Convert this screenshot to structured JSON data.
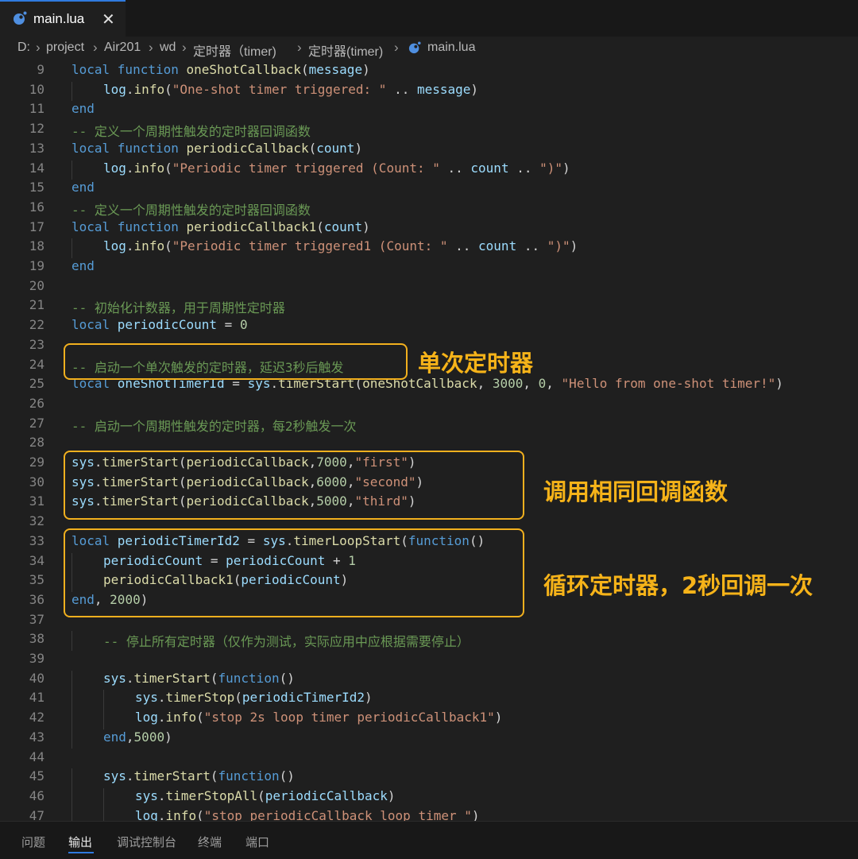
{
  "tab": {
    "title": "main.lua",
    "close": "✕"
  },
  "breadcrumb": [
    "D:",
    "project",
    "Air201",
    "wd",
    "定时器（timer)",
    "定时器(timer)",
    "main.lua"
  ],
  "code": [
    {
      "n": "9",
      "indent": 0,
      "tokens": [
        [
          "kw",
          "local "
        ],
        [
          "kw",
          "function "
        ],
        [
          "fn",
          "oneShotCallback"
        ],
        [
          "op",
          "("
        ],
        [
          "vr",
          "message"
        ],
        [
          "op",
          ")"
        ]
      ]
    },
    {
      "n": "10",
      "indent": 1,
      "tokens": [
        [
          "vr",
          "log"
        ],
        [
          "op",
          "."
        ],
        [
          "fn",
          "info"
        ],
        [
          "op",
          "("
        ],
        [
          "st",
          "\"One-shot timer triggered: \""
        ],
        [
          "op",
          " .. "
        ],
        [
          "vr",
          "message"
        ],
        [
          "op",
          ")"
        ]
      ]
    },
    {
      "n": "11",
      "indent": 0,
      "tokens": [
        [
          "kw",
          "end"
        ]
      ]
    },
    {
      "n": "12",
      "indent": 0,
      "tokens": [
        [
          "cm",
          "-- 定义一个周期性触发的定时器回调函数"
        ]
      ]
    },
    {
      "n": "13",
      "indent": 0,
      "tokens": [
        [
          "kw",
          "local "
        ],
        [
          "kw",
          "function "
        ],
        [
          "fn",
          "periodicCallback"
        ],
        [
          "op",
          "("
        ],
        [
          "vr",
          "count"
        ],
        [
          "op",
          ")"
        ]
      ]
    },
    {
      "n": "14",
      "indent": 1,
      "tokens": [
        [
          "vr",
          "log"
        ],
        [
          "op",
          "."
        ],
        [
          "fn",
          "info"
        ],
        [
          "op",
          "("
        ],
        [
          "st",
          "\"Periodic timer triggered (Count: \""
        ],
        [
          "op",
          " .. "
        ],
        [
          "vr",
          "count"
        ],
        [
          "op",
          " .. "
        ],
        [
          "st",
          "\")\""
        ],
        [
          "op",
          ")"
        ]
      ]
    },
    {
      "n": "15",
      "indent": 0,
      "tokens": [
        [
          "kw",
          "end"
        ]
      ]
    },
    {
      "n": "16",
      "indent": 0,
      "tokens": [
        [
          "cm",
          "-- 定义一个周期性触发的定时器回调函数"
        ]
      ]
    },
    {
      "n": "17",
      "indent": 0,
      "tokens": [
        [
          "kw",
          "local "
        ],
        [
          "kw",
          "function "
        ],
        [
          "fn",
          "periodicCallback1"
        ],
        [
          "op",
          "("
        ],
        [
          "vr",
          "count"
        ],
        [
          "op",
          ")"
        ]
      ]
    },
    {
      "n": "18",
      "indent": 1,
      "tokens": [
        [
          "vr",
          "log"
        ],
        [
          "op",
          "."
        ],
        [
          "fn",
          "info"
        ],
        [
          "op",
          "("
        ],
        [
          "st",
          "\"Periodic timer triggered1 (Count: \""
        ],
        [
          "op",
          " .. "
        ],
        [
          "vr",
          "count"
        ],
        [
          "op",
          " .. "
        ],
        [
          "st",
          "\")\""
        ],
        [
          "op",
          ")"
        ]
      ]
    },
    {
      "n": "19",
      "indent": 0,
      "tokens": [
        [
          "kw",
          "end"
        ]
      ]
    },
    {
      "n": "20",
      "indent": 0,
      "tokens": []
    },
    {
      "n": "21",
      "indent": 0,
      "tokens": [
        [
          "cm",
          "-- 初始化计数器，用于周期性定时器"
        ]
      ]
    },
    {
      "n": "22",
      "indent": 0,
      "tokens": [
        [
          "kw",
          "local "
        ],
        [
          "vr",
          "periodicCount"
        ],
        [
          "op",
          " = "
        ],
        [
          "nm",
          "0"
        ]
      ]
    },
    {
      "n": "23",
      "indent": 0,
      "tokens": []
    },
    {
      "n": "24",
      "indent": 0,
      "tokens": [
        [
          "cm",
          "-- 启动一个单次触发的定时器，延迟3秒后触发"
        ]
      ]
    },
    {
      "n": "25",
      "indent": 0,
      "tokens": [
        [
          "kw",
          "local "
        ],
        [
          "vr",
          "oneShotTimerId"
        ],
        [
          "op",
          " = "
        ],
        [
          "vr",
          "sys"
        ],
        [
          "op",
          "."
        ],
        [
          "fn",
          "timerStart"
        ],
        [
          "op",
          "("
        ],
        [
          "fn",
          "oneShotCallback"
        ],
        [
          "op",
          ", "
        ],
        [
          "nm",
          "3000"
        ],
        [
          "op",
          ", "
        ],
        [
          "nm",
          "0"
        ],
        [
          "op",
          ", "
        ],
        [
          "st",
          "\"Hello from one-shot timer!\""
        ],
        [
          "op",
          ")"
        ]
      ]
    },
    {
      "n": "26",
      "indent": 0,
      "tokens": []
    },
    {
      "n": "27",
      "indent": 0,
      "tokens": [
        [
          "cm",
          "-- 启动一个周期性触发的定时器，每2秒触发一次"
        ]
      ]
    },
    {
      "n": "28",
      "indent": 0,
      "tokens": []
    },
    {
      "n": "29",
      "indent": 0,
      "tokens": [
        [
          "vr",
          "sys"
        ],
        [
          "op",
          "."
        ],
        [
          "fn",
          "timerStart"
        ],
        [
          "op",
          "("
        ],
        [
          "fn",
          "periodicCallback"
        ],
        [
          "op",
          ","
        ],
        [
          "nm",
          "7000"
        ],
        [
          "op",
          ","
        ],
        [
          "st",
          "\"first\""
        ],
        [
          "op",
          ")"
        ]
      ]
    },
    {
      "n": "30",
      "indent": 0,
      "tokens": [
        [
          "vr",
          "sys"
        ],
        [
          "op",
          "."
        ],
        [
          "fn",
          "timerStart"
        ],
        [
          "op",
          "("
        ],
        [
          "fn",
          "periodicCallback"
        ],
        [
          "op",
          ","
        ],
        [
          "nm",
          "6000"
        ],
        [
          "op",
          ","
        ],
        [
          "st",
          "\"second\""
        ],
        [
          "op",
          ")"
        ]
      ]
    },
    {
      "n": "31",
      "indent": 0,
      "tokens": [
        [
          "vr",
          "sys"
        ],
        [
          "op",
          "."
        ],
        [
          "fn",
          "timerStart"
        ],
        [
          "op",
          "("
        ],
        [
          "fn",
          "periodicCallback"
        ],
        [
          "op",
          ","
        ],
        [
          "nm",
          "5000"
        ],
        [
          "op",
          ","
        ],
        [
          "st",
          "\"third\""
        ],
        [
          "op",
          ")"
        ]
      ]
    },
    {
      "n": "32",
      "indent": 0,
      "tokens": []
    },
    {
      "n": "33",
      "indent": 0,
      "tokens": [
        [
          "kw",
          "local "
        ],
        [
          "vr",
          "periodicTimerId2"
        ],
        [
          "op",
          " = "
        ],
        [
          "vr",
          "sys"
        ],
        [
          "op",
          "."
        ],
        [
          "fn",
          "timerLoopStart"
        ],
        [
          "op",
          "("
        ],
        [
          "kw",
          "function"
        ],
        [
          "op",
          "()"
        ]
      ]
    },
    {
      "n": "34",
      "indent": 1,
      "tokens": [
        [
          "vr",
          "periodicCount"
        ],
        [
          "op",
          " = "
        ],
        [
          "vr",
          "periodicCount"
        ],
        [
          "op",
          " + "
        ],
        [
          "nm",
          "1"
        ]
      ]
    },
    {
      "n": "35",
      "indent": 1,
      "tokens": [
        [
          "fn",
          "periodicCallback1"
        ],
        [
          "op",
          "("
        ],
        [
          "vr",
          "periodicCount"
        ],
        [
          "op",
          ")"
        ]
      ]
    },
    {
      "n": "36",
      "indent": 0,
      "tokens": [
        [
          "kw",
          "end"
        ],
        [
          "op",
          ", "
        ],
        [
          "nm",
          "2000"
        ],
        [
          "op",
          ")"
        ]
      ]
    },
    {
      "n": "37",
      "indent": 0,
      "tokens": []
    },
    {
      "n": "38",
      "indent": 1,
      "tokens": [
        [
          "cm",
          "-- 停止所有定时器（仅作为测试，实际应用中应根据需要停止）"
        ]
      ]
    },
    {
      "n": "39",
      "indent": 0,
      "tokens": []
    },
    {
      "n": "40",
      "indent": 1,
      "tokens": [
        [
          "vr",
          "sys"
        ],
        [
          "op",
          "."
        ],
        [
          "fn",
          "timerStart"
        ],
        [
          "op",
          "("
        ],
        [
          "kw",
          "function"
        ],
        [
          "op",
          "()"
        ]
      ]
    },
    {
      "n": "41",
      "indent": 2,
      "tokens": [
        [
          "vr",
          "sys"
        ],
        [
          "op",
          "."
        ],
        [
          "fn",
          "timerStop"
        ],
        [
          "op",
          "("
        ],
        [
          "vr",
          "periodicTimerId2"
        ],
        [
          "op",
          ")"
        ]
      ]
    },
    {
      "n": "42",
      "indent": 2,
      "tokens": [
        [
          "vr",
          "log"
        ],
        [
          "op",
          "."
        ],
        [
          "fn",
          "info"
        ],
        [
          "op",
          "("
        ],
        [
          "st",
          "\"stop 2s loop timer periodicCallback1\""
        ],
        [
          "op",
          ")"
        ]
      ]
    },
    {
      "n": "43",
      "indent": 1,
      "tokens": [
        [
          "kw",
          "end"
        ],
        [
          "op",
          ","
        ],
        [
          "nm",
          "5000"
        ],
        [
          "op",
          ")"
        ]
      ]
    },
    {
      "n": "44",
      "indent": 0,
      "tokens": []
    },
    {
      "n": "45",
      "indent": 1,
      "tokens": [
        [
          "vr",
          "sys"
        ],
        [
          "op",
          "."
        ],
        [
          "fn",
          "timerStart"
        ],
        [
          "op",
          "("
        ],
        [
          "kw",
          "function"
        ],
        [
          "op",
          "()"
        ]
      ]
    },
    {
      "n": "46",
      "indent": 2,
      "tokens": [
        [
          "vr",
          "sys"
        ],
        [
          "op",
          "."
        ],
        [
          "fn",
          "timerStopAll"
        ],
        [
          "op",
          "("
        ],
        [
          "vr",
          "periodicCallback"
        ],
        [
          "op",
          ")"
        ]
      ]
    },
    {
      "n": "47",
      "indent": 2,
      "tokens": [
        [
          "vr",
          "log"
        ],
        [
          "op",
          "."
        ],
        [
          "fn",
          "info"
        ],
        [
          "op",
          "("
        ],
        [
          "st",
          "\"stop periodicCallback loop timer \""
        ],
        [
          "op",
          ")"
        ]
      ]
    }
  ],
  "annotations": [
    {
      "name": "single-timer",
      "label": "单次定时器"
    },
    {
      "name": "same-callback",
      "label": "调用相同回调函数"
    },
    {
      "name": "loop-timer",
      "label": "循环定时器，2秒回调一次"
    }
  ],
  "panel": {
    "tabs": [
      "问题",
      "输出",
      "调试控制台",
      "终端",
      "端口"
    ],
    "active": "输出"
  },
  "colors": {
    "accent": "#f6b319",
    "tab_accent": "#2f7adf",
    "background": "#1f1f1f"
  }
}
